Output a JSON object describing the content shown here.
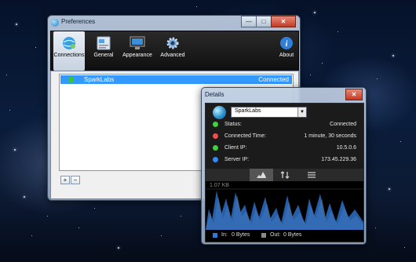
{
  "prefs": {
    "title": "Preferences",
    "window_buttons": {
      "minimize": "—",
      "maximize": "□",
      "close": "✕"
    },
    "toolbar": [
      {
        "label": "Connections",
        "icon": "connections-icon"
      },
      {
        "label": "General",
        "icon": "general-icon"
      },
      {
        "label": "Appearance",
        "icon": "appearance-icon"
      },
      {
        "label": "Advanced",
        "icon": "advanced-icon"
      },
      {
        "label": "About",
        "icon": "about-icon"
      }
    ],
    "connections": [
      {
        "name": "SparkLabs",
        "status": "Connected"
      }
    ],
    "add_label": "+",
    "remove_label": "−"
  },
  "details": {
    "title": "Details",
    "close": "✕",
    "selected_connection": "SparkLabs",
    "rows": [
      {
        "label": "Status:",
        "value": "Connected",
        "color": "#3bd23b"
      },
      {
        "label": "Connected Time:",
        "value": "1 minute, 30 seconds",
        "color": "#ff4a4a"
      },
      {
        "label": "Client IP:",
        "value": "10.5.0.6",
        "color": "#3bd23b"
      },
      {
        "label": "Server IP:",
        "value": "173.45.229.36",
        "color": "#2e8cff"
      }
    ],
    "tabs": [
      "graph-tab",
      "transfer-tab",
      "log-tab"
    ],
    "graph_label": "1.07 KB",
    "legend": {
      "in_label": "In:",
      "in_value": "0 Bytes",
      "in_color": "#2e7bd6",
      "out_label": "Out:",
      "out_value": "0 Bytes",
      "out_color": "#8a8a8a"
    }
  }
}
